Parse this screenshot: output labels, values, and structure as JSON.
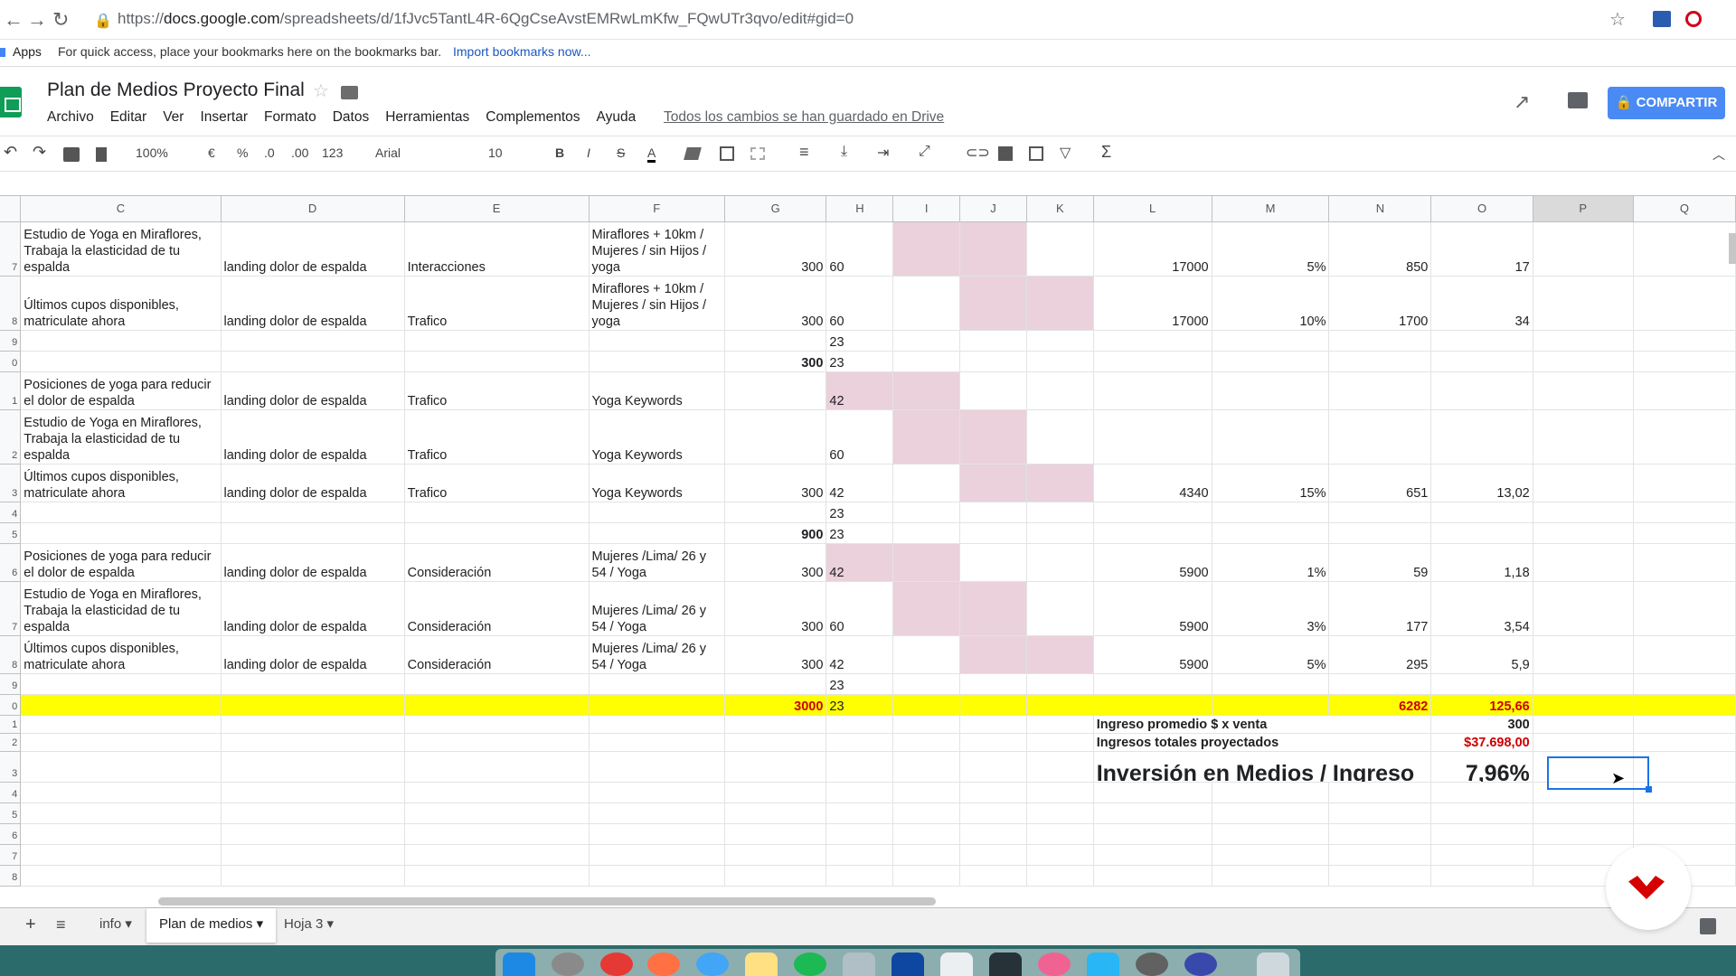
{
  "browser": {
    "url_prefix": "https://",
    "url_host": "docs.google.com",
    "url_path": "/spreadsheets/d/1fJvc5TantL4R-6QgCseAvstEMRwLmKfw_FQwUTr3qvo/edit#gid=0",
    "bookmarks_apps": "Apps",
    "bookmarks_hint": "For quick access, place your bookmarks here on the bookmarks bar.",
    "bookmarks_import": "Import bookmarks now..."
  },
  "doc": {
    "title": "Plan de Medios Proyecto Final",
    "menus": [
      "Archivo",
      "Editar",
      "Ver",
      "Insertar",
      "Formato",
      "Datos",
      "Herramientas",
      "Complementos",
      "Ayuda"
    ],
    "save_status": "Todos los cambios se han guardado en Drive",
    "share_label": "COMPARTIR"
  },
  "toolbar": {
    "zoom": "100%",
    "currency": "€",
    "percent": "%",
    "dec_less": ".0",
    "dec_more": ".00",
    "more_formats": "123",
    "font": "Arial",
    "font_size": "10",
    "bold": "B",
    "italic": "I",
    "strike": "S",
    "text_color": "A",
    "functions": "Σ"
  },
  "columns": [
    "C",
    "D",
    "E",
    "F",
    "G",
    "H",
    "I",
    "J",
    "K",
    "L",
    "M",
    "N",
    "O",
    "P",
    "Q"
  ],
  "rows": [
    {
      "h": 60,
      "rn": "7",
      "c": "Estudio de Yoga en Miraflores, Trabaja la elasticidad de tu espalda",
      "d": "landing dolor de espalda",
      "e": "Interacciones",
      "f": "Miraflores + 10km / Mujeres / sin Hijos / yoga",
      "g": "300",
      "pink": [
        "I",
        "J"
      ],
      "l": "17000",
      "m": "5%",
      "n": "850",
      "o": "17"
    },
    {
      "h": 60,
      "rn": "8",
      "c": "Últimos cupos disponibles, matriculate ahora",
      "d": "landing dolor de espalda",
      "e": "Trafico",
      "f": "Miraflores + 10km / Mujeres / sin Hijos / yoga",
      "g": "300",
      "pink": [
        "J",
        "K"
      ],
      "l": "17000",
      "m": "10%",
      "n": "1700",
      "o": "34"
    },
    {
      "h": 23,
      "rn": "9"
    },
    {
      "h": 23,
      "rn": "0",
      "g": "300",
      "gbold": true
    },
    {
      "h": 42,
      "rn": "1",
      "c": "Posiciones de yoga para reducir el dolor de espalda",
      "d": "landing dolor de espalda",
      "e": "Trafico",
      "f": "Yoga Keywords",
      "pink": [
        "H",
        "I"
      ]
    },
    {
      "h": 60,
      "rn": "2",
      "c": "Estudio de Yoga en Miraflores, Trabaja la elasticidad de tu espalda",
      "d": "landing dolor de espalda",
      "e": "Trafico",
      "f": "Yoga Keywords",
      "pink": [
        "I",
        "J"
      ]
    },
    {
      "h": 42,
      "rn": "3",
      "c": "Últimos cupos disponibles, matriculate ahora",
      "d": "landing dolor de espalda",
      "e": "Trafico",
      "f": "Yoga Keywords",
      "g": "300",
      "pink": [
        "J",
        "K"
      ],
      "l": "4340",
      "m": "15%",
      "n": "651",
      "o": "13,02"
    },
    {
      "h": 23,
      "rn": "4"
    },
    {
      "h": 23,
      "rn": "5",
      "g": "900",
      "gbold": true
    },
    {
      "h": 42,
      "rn": "6",
      "c": "Posiciones de yoga para reducir el dolor de espalda",
      "d": "landing dolor de espalda",
      "e": "Consideración",
      "f": "Mujeres /Lima/  26 y 54 / Yoga",
      "g": "300",
      "pink": [
        "H",
        "I"
      ],
      "l": "5900",
      "m": "1%",
      "n": "59",
      "o": "1,18"
    },
    {
      "h": 60,
      "rn": "7",
      "c": "Estudio de Yoga en Miraflores, Trabaja la elasticidad de tu espalda",
      "d": "landing dolor de espalda",
      "e": "Consideración",
      "f": "Mujeres /Lima/  26 y 54 / Yoga",
      "g": "300",
      "pink": [
        "I",
        "J"
      ],
      "l": "5900",
      "m": "3%",
      "n": "177",
      "o": "3,54"
    },
    {
      "h": 42,
      "rn": "8",
      "c": "Últimos cupos disponibles, matriculate ahora",
      "d": "landing dolor de espalda",
      "e": "Consideración",
      "f": "Mujeres /Lima/  26 y 54 / Yoga",
      "g": "300",
      "pink": [
        "J",
        "K"
      ],
      "l": "5900",
      "m": "5%",
      "n": "295",
      "o": "5,9"
    },
    {
      "h": 23,
      "rn": "9"
    },
    {
      "h": 23,
      "rn": "0",
      "yellow": true,
      "g": "3000",
      "n": "6282",
      "o": "125,66"
    }
  ],
  "summary": {
    "avg_label": "Ingreso promedio $ x venta",
    "avg_value": "300",
    "total_label": "Ingresos totales proyectados",
    "total_value": "$37.698,00",
    "ratio_label": "Inversión en Medios / Ingreso",
    "ratio_value": "7,96%",
    "row_numbers": [
      "1",
      "2",
      "3"
    ]
  },
  "empty_row_numbers": [
    "4",
    "5",
    "6",
    "7",
    "8"
  ],
  "sheet_tabs": [
    "info",
    "Plan de medios",
    "Hoja 3"
  ],
  "active_tab": "Plan de medios",
  "colors": {
    "pink": "#ead1dc",
    "yellow": "#ffff00",
    "share": "#4a8af4",
    "red_value": "#cc0000"
  }
}
